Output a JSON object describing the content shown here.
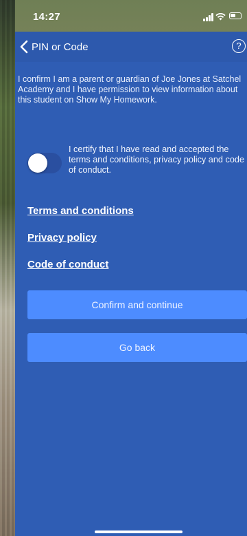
{
  "status_bar": {
    "time": "14:27",
    "signal_icon": "signal-icon",
    "wifi_icon": "wifi-icon",
    "battery_icon": "battery-icon"
  },
  "nav": {
    "back_label": "PIN or Code",
    "back_icon": "chevron-left-icon",
    "help_glyph": "?",
    "help_icon": "help-icon"
  },
  "content": {
    "confirm_text": "I confirm I am a parent or guardian of Joe Jones at Satchel Academy and I have permission to view information about this student on Show My Homework.",
    "toggle_label": "I certify that I have read and accepted the terms and conditions, privacy policy and code of conduct.",
    "toggle_on": false
  },
  "links": {
    "terms": "Terms and conditions",
    "privacy": "Privacy policy",
    "conduct": "Code of conduct"
  },
  "buttons": {
    "confirm": "Confirm and continue",
    "back": "Go back"
  },
  "colors": {
    "panel": "#2f5db4",
    "button": "#4d8cff",
    "text": "#ffffff"
  }
}
